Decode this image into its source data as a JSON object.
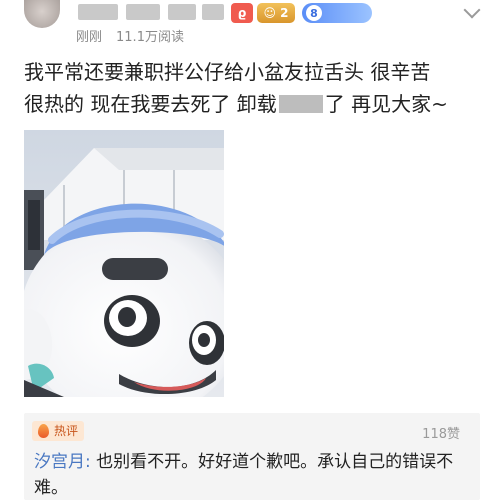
{
  "header": {
    "badges": {
      "red": "ϱ",
      "gold": "☺ 2",
      "blue": "8"
    },
    "meta": {
      "time": "刚刚",
      "reads": "11.1万阅读"
    }
  },
  "post": {
    "line1": "我平常还要兼职拌公仔给小盆友拉舌头 很辛苦",
    "line2_a": "很热的 现在我要去死了 卸载",
    "line2_b": "了 再见大家~"
  },
  "comment": {
    "tag": "热评",
    "likes": "118赞",
    "author": "汐宫月:",
    "text": " 也别看不开。好好道个歉吧。承认自己的错误不难。"
  },
  "colors": {
    "author": "#4a78c2",
    "hot": "#c8551b",
    "mascot": "#7ea4e6"
  }
}
